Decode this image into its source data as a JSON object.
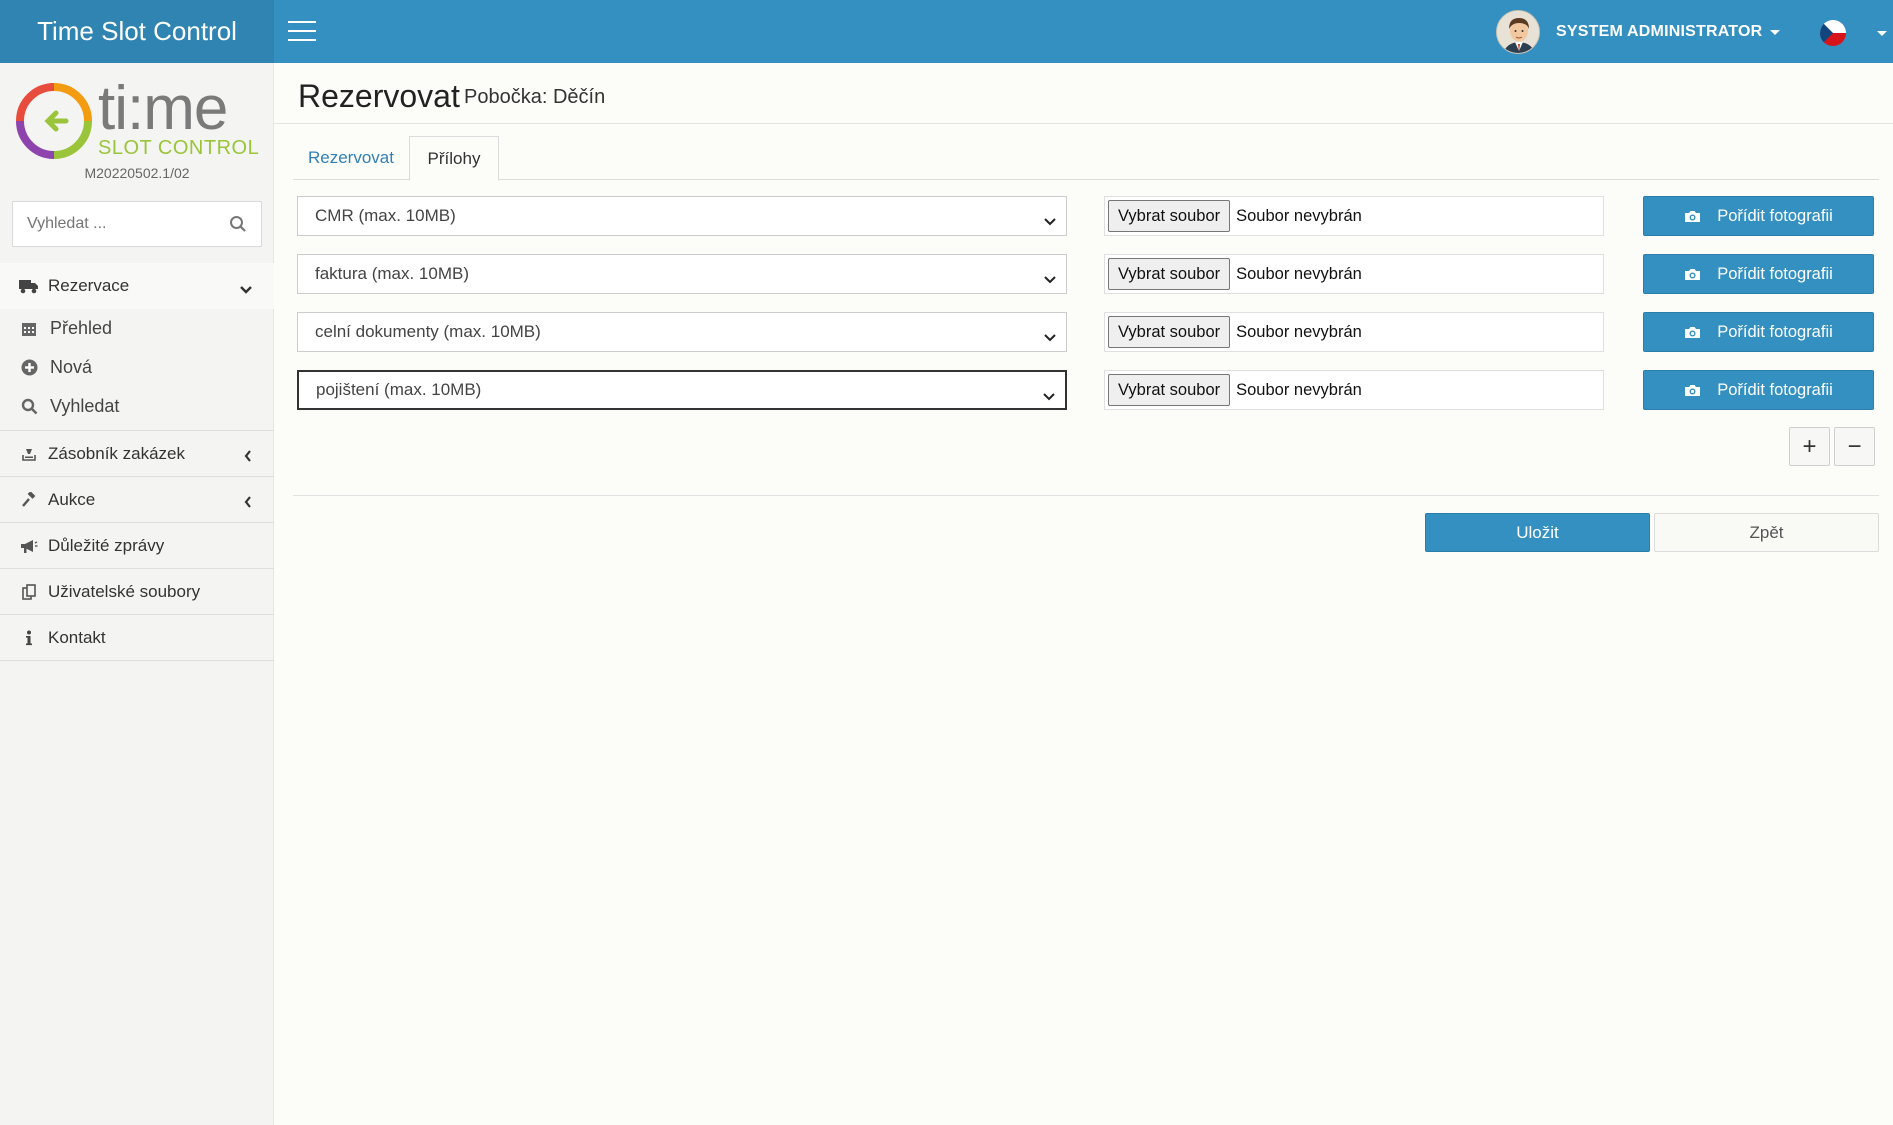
{
  "app": {
    "title": "Time Slot Control"
  },
  "topbar": {
    "user_name": "SYSTEM ADMINISTRATOR",
    "language": "cs"
  },
  "logo": {
    "text_main": "ti:me",
    "text_sub": "SLOT CONTROL"
  },
  "sidebar": {
    "version": "M20220502.1/02",
    "search_placeholder": "Vyhledat ...",
    "menu": {
      "rezervace": "Rezervace",
      "prehled": "Přehled",
      "nova": "Nová",
      "vyhledat": "Vyhledat",
      "zasobnik": "Zásobník zakázek",
      "aukce": "Aukce",
      "zpravy": "Důležité zprávy",
      "soubory": "Uživatelské soubory",
      "kontakt": "Kontakt"
    }
  },
  "page": {
    "title": "Rezervovat",
    "subtitle": "Pobočka: Děčín"
  },
  "tabs": {
    "rezervovat": "Rezervovat",
    "prilohy": "Přílohy"
  },
  "attachments": [
    {
      "type": "CMR (max. 10MB)",
      "file_button": "Vybrat soubor",
      "file_status": "Soubor nevybrán",
      "photo_button": "Pořídit fotografii"
    },
    {
      "type": "faktura (max. 10MB)",
      "file_button": "Vybrat soubor",
      "file_status": "Soubor nevybrán",
      "photo_button": "Pořídit fotografii"
    },
    {
      "type": "celní dokumenty (max. 10MB)",
      "file_button": "Vybrat soubor",
      "file_status": "Soubor nevybrán",
      "photo_button": "Pořídit fotografii"
    },
    {
      "type": "pojištení (max. 10MB)",
      "file_button": "Vybrat soubor",
      "file_status": "Soubor nevybrán",
      "photo_button": "Pořídit fotografii"
    }
  ],
  "controls": {
    "add": "+",
    "remove": "−"
  },
  "actions": {
    "save": "Uložit",
    "back": "Zpět"
  },
  "colors": {
    "primary": "#3490c0",
    "brand_dark": "#2f84b2",
    "logo_green": "#9ac53a",
    "link": "#3180b8"
  },
  "icons": [
    "menu-icon",
    "caret-icon",
    "czech-flag-icon",
    "search-icon",
    "truck-icon",
    "calendar-icon",
    "plus-circle-icon",
    "search-icon",
    "chevron-down-icon",
    "chevron-left-icon",
    "inbox-icon",
    "gavel-icon",
    "megaphone-icon",
    "files-icon",
    "info-icon",
    "camera-icon"
  ]
}
